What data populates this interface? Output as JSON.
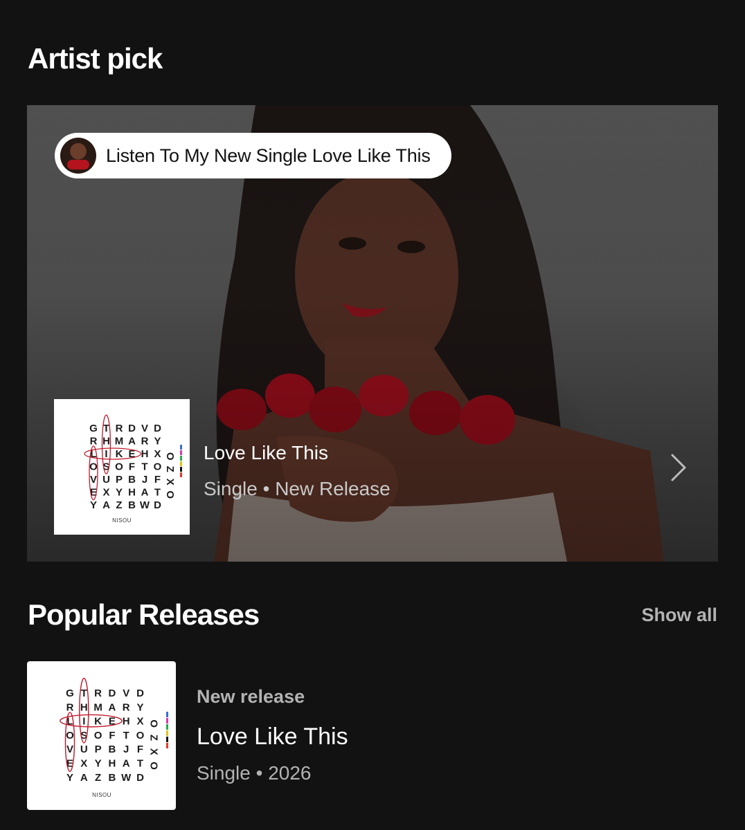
{
  "artist_pick": {
    "title": "Artist pick",
    "pill_text": "Listen To My New Single Love Like This",
    "release_name": "Love Like This",
    "release_meta": "Single • New Release"
  },
  "popular_releases": {
    "title": "Popular Releases",
    "show_all_label": "Show all",
    "items": [
      {
        "label": "New release",
        "name": "Love Like This",
        "meta": "Single • 2026"
      }
    ]
  },
  "cover_art": {
    "rows": [
      "GTRDVD",
      "RHMARY",
      "LIKEHX",
      "OSOFTO",
      "VUPBJF",
      "EXYHAT",
      "YAZBWD"
    ],
    "side_column": "OZXO",
    "artist": "NISOU",
    "circle_color": "#c0182a"
  },
  "icons": {
    "chevron": "chevron-right-icon",
    "avatar": "artist-avatar"
  }
}
